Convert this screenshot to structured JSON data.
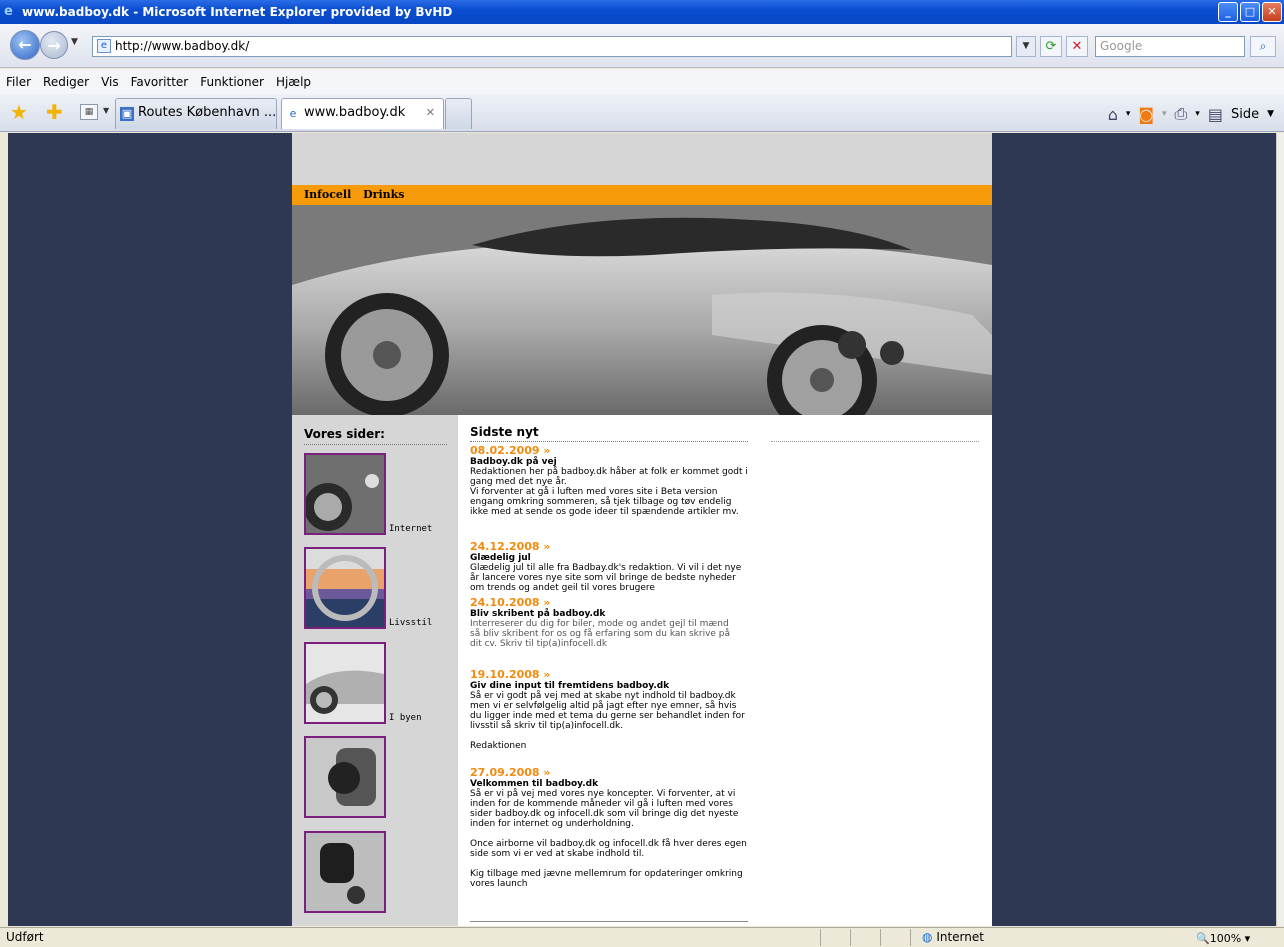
{
  "window": {
    "title": "www.badboy.dk - Microsoft Internet Explorer provided by BvHD"
  },
  "address": {
    "url": "http://www.badboy.dk/",
    "search_placeholder": "Google"
  },
  "menu": [
    "Filer",
    "Rediger",
    "Vis",
    "Favoritter",
    "Funktioner",
    "Hjælp"
  ],
  "tabs": [
    {
      "label": "Routes København ..."
    },
    {
      "label": "www.badboy.dk"
    }
  ],
  "commandbar": {
    "page_label": "Side"
  },
  "site": {
    "nav": [
      "Infocell",
      "Drinks"
    ],
    "left_heading": "Vores sider:",
    "thumbs": [
      {
        "label": "Internet"
      },
      {
        "label": "Livsstil"
      },
      {
        "label": "I byen"
      },
      {
        "label": ""
      },
      {
        "label": ""
      }
    ],
    "news_heading": "Sidste nyt",
    "news": [
      {
        "date": "08.02.2009 »",
        "title": "Badboy.dk på vej",
        "body": [
          "Redaktionen her på badboy.dk håber at folk er kommet godt i",
          "gang med det nye år.",
          "Vi forventer at gå i luften med vores site i Beta version",
          "engang omkring sommeren, så tjek tilbage og tøv endelig",
          "ikke med at sende os gode ideer til spændende artikler mv."
        ]
      },
      {
        "date": "24.12.2008 »",
        "title": "Glædelig jul",
        "body": [
          "Glædelig jul til alle fra Badbay.dk's redaktion. Vi vil i det nye",
          "år lancere vores nye site som vil bringe de bedste nyheder",
          "om trends og andet geil til vores brugere"
        ]
      },
      {
        "date": "24.10.2008 »",
        "title": "Bliv skribent på badboy.dk",
        "body": [
          "Interreserer du dig for biler, mode og andet gejl til mænd",
          "så bliv skribent for os og få erfaring som du kan skrive på",
          "dit cv. Skriv til tip(a)infocell.dk"
        ]
      },
      {
        "date": "19.10.2008 »",
        "title": "Giv dine input til fremtidens badboy.dk",
        "body": [
          "Så er vi godt på vej med at skabe nyt indhold til badboy.dk",
          "men vi er selvfølgelig altid på jagt efter nye emner, så hvis",
          "du ligger inde med et tema du gerne ser behandlet inden for",
          "livsstil så skriv til tip(a)infocell.dk.",
          "",
          "Redaktionen"
        ]
      },
      {
        "date": "27.09.2008 »",
        "title": "Velkommen til badboy.dk",
        "body": [
          "Så er vi på vej med vores nye koncepter. Vi forventer, at vi",
          "inden for de kommende måneder vil gå i luften med vores",
          "sider badboy.dk og infocell.dk som vil bringe dig det nyeste",
          "inden for internet og underholdning.",
          "",
          "Once airborne vil badboy.dk og infocell.dk få hver deres egen",
          "side som vi er ved at skabe indhold til.",
          "",
          "Kig tilbage med jævne mellemrum for opdateringer omkring",
          "vores launch"
        ]
      }
    ]
  },
  "status": {
    "text": "Udført",
    "zone": "Internet",
    "zoom": "100%"
  },
  "colors": {
    "accent": "#f79b0a",
    "background": "#2f3852",
    "thumb_border": "#7b1f7e"
  }
}
